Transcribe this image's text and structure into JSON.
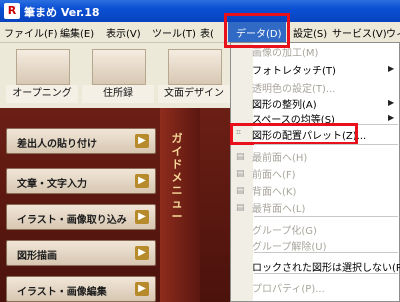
{
  "window": {
    "title": "筆まめ Ver.18",
    "app_icon_glyph": "R"
  },
  "menubar": {
    "items": [
      {
        "label": "ファイル(F)"
      },
      {
        "label": "編集(E)"
      },
      {
        "label": "表示(V)"
      },
      {
        "label": "ツール(T)"
      },
      {
        "label": "表("
      },
      {
        "label": "データ(D)"
      },
      {
        "label": "設定(S)"
      },
      {
        "label": "サービス(V)"
      },
      {
        "label": "ウィ"
      }
    ]
  },
  "toolbar": {
    "items": [
      {
        "label": "オープニング"
      },
      {
        "label": "住所録"
      },
      {
        "label": "文面デザイン"
      }
    ]
  },
  "guide": {
    "title": "ガイドメニュー"
  },
  "left_buttons": [
    {
      "label": "差出人の貼り付け"
    },
    {
      "label": "文章・文字入力"
    },
    {
      "label": "イラスト・画像取り込み"
    },
    {
      "label": "図形描画"
    },
    {
      "label": "イラスト・画像編集"
    }
  ],
  "dropdown": {
    "items": [
      {
        "label": "画像の加工(M)",
        "enabled": false,
        "submenu": false
      },
      {
        "label": "フォトレタッチ(T)",
        "enabled": true,
        "submenu": true
      },
      {
        "label": "透明色の設定(T)...",
        "enabled": false,
        "submenu": false
      },
      {
        "label": "図形の整列(A)",
        "enabled": true,
        "submenu": true
      },
      {
        "label": "スペースの均等(S)",
        "enabled": true,
        "submenu": true
      },
      {
        "label": "図形の配置パレット(Z)...",
        "enabled": true,
        "submenu": false
      },
      {
        "label": "最前面へ(H)",
        "enabled": false,
        "submenu": false
      },
      {
        "label": "前面へ(F)",
        "enabled": false,
        "submenu": false
      },
      {
        "label": "背面へ(K)",
        "enabled": false,
        "submenu": false
      },
      {
        "label": "最背面へ(L)",
        "enabled": false,
        "submenu": false
      },
      {
        "label": "グループ化(G)",
        "enabled": false,
        "submenu": false
      },
      {
        "label": "グループ解除(U)",
        "enabled": false,
        "submenu": false
      },
      {
        "label": "ロックされた図形は選択しない(R)",
        "enabled": true,
        "submenu": false
      },
      {
        "label": "プロパティ(P)...",
        "enabled": false,
        "submenu": false
      }
    ]
  },
  "colors": {
    "highlight_box": "#e8101a",
    "menu_active": "#316ac5",
    "title_bar": "#0a4fd3"
  },
  "icons": {
    "submenu_arrow": "▶"
  }
}
